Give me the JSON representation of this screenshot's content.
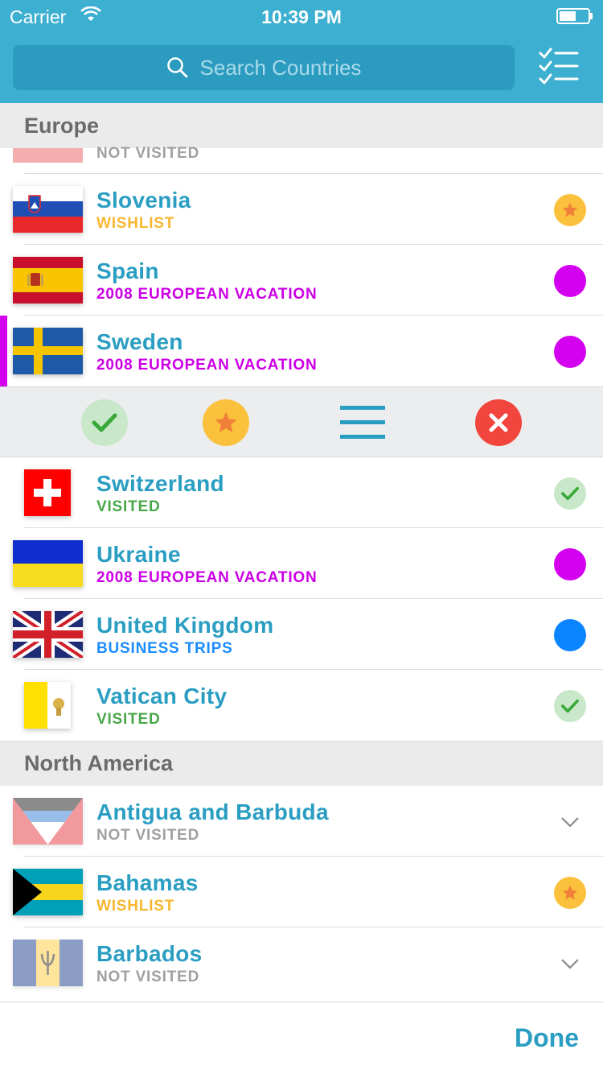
{
  "status_bar": {
    "carrier": "Carrier",
    "time": "10:39 PM"
  },
  "search": {
    "placeholder": "Search Countries"
  },
  "sections": {
    "europe": "Europe",
    "north_america": "North America"
  },
  "europe_rows": [
    {
      "name": "",
      "status": "NOT VISITED",
      "status_color": "#a0a0a0"
    },
    {
      "name": "Slovenia",
      "status": "WISHLIST",
      "status_color": "#f7b731",
      "marker": "wishlist"
    },
    {
      "name": "Spain",
      "status": "2008 EUROPEAN VACATION",
      "status_color": "#cc00e6",
      "marker": "list",
      "marker_color": "#d400f0"
    },
    {
      "name": "Sweden",
      "status": "2008 EUROPEAN VACATION",
      "status_color": "#cc00e6",
      "marker": "list",
      "marker_color": "#d400f0",
      "selected": true
    },
    {
      "name": "Switzerland",
      "status": "VISITED",
      "status_color": "#4aa84a",
      "marker": "visited"
    },
    {
      "name": "Ukraine",
      "status": "2008 EUROPEAN VACATION",
      "status_color": "#cc00e6",
      "marker": "list",
      "marker_color": "#d400f0"
    },
    {
      "name": "United Kingdom",
      "status": "BUSINESS TRIPS",
      "status_color": "#1a8cff",
      "marker": "list",
      "marker_color": "#0a84ff"
    },
    {
      "name": "Vatican City",
      "status": "VISITED",
      "status_color": "#4aa84a",
      "marker": "visited"
    }
  ],
  "north_america_rows": [
    {
      "name": "Antigua and Barbuda",
      "status": "NOT VISITED",
      "status_color": "#a0a0a0",
      "marker": "chevron"
    },
    {
      "name": "Bahamas",
      "status": "WISHLIST",
      "status_color": "#f7b731",
      "marker": "wishlist"
    },
    {
      "name": "Barbados",
      "status": "NOT VISITED",
      "status_color": "#a0a0a0",
      "marker": "chevron"
    }
  ],
  "action_bar": {
    "visited_color": "#c9e8c9",
    "wishlist_color": "#fbc13c",
    "lists_color": "#2a9ec2",
    "remove_color": "#f2453d"
  },
  "colors": {
    "brand": "#3dafd0",
    "selected_accent": "#d400f0"
  },
  "bottom": {
    "done_label": "Done"
  }
}
